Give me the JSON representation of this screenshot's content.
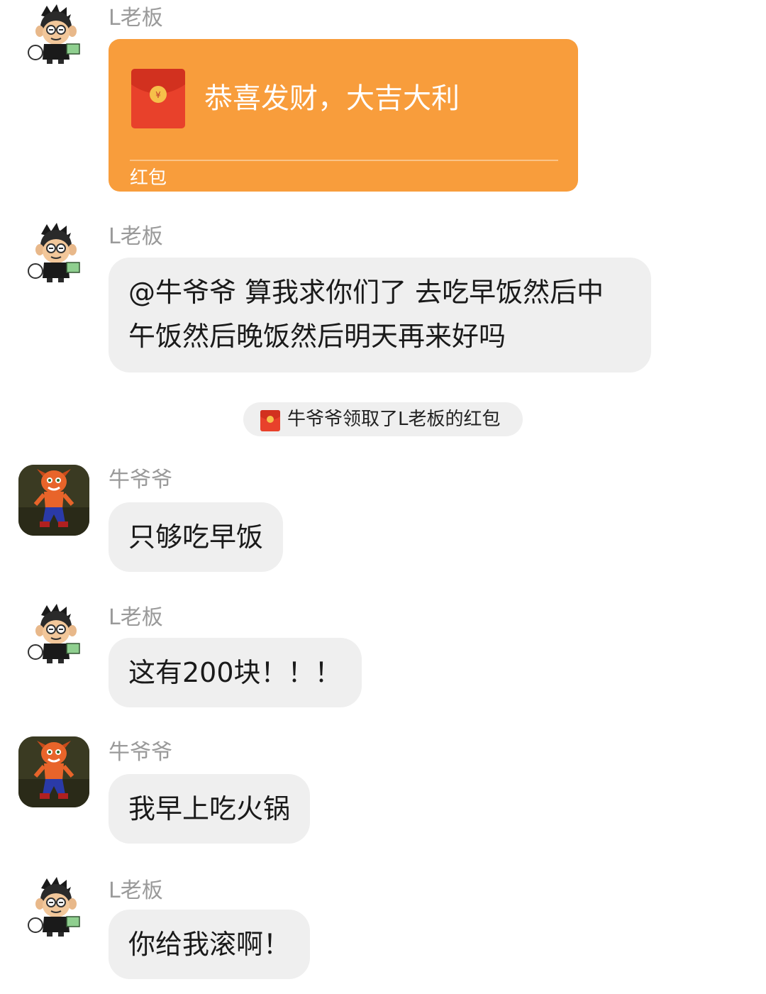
{
  "colors": {
    "red_packet_bg": "#f89d3c",
    "bubble_bg": "#efefef",
    "sender_name": "#9a9a9a"
  },
  "messages": [
    {
      "sender": "L老板",
      "avatar": "monkey-avatar",
      "type": "red_packet",
      "greeting": "恭喜发财，大吉大利",
      "label": "红包"
    },
    {
      "sender": "L老板",
      "avatar": "monkey-avatar",
      "type": "text",
      "line1": "@牛爷爷 算我求你们了 去吃早饭然后中",
      "line2": "午饭然后晚饭然后明天再来好吗"
    },
    {
      "type": "system",
      "icon": "red-packet-icon",
      "text": "牛爷爷领取了L老板的红包"
    },
    {
      "sender": "牛爷爷",
      "avatar": "crash-avatar",
      "type": "text",
      "text": "只够吃早饭"
    },
    {
      "sender": "L老板",
      "avatar": "monkey-avatar",
      "type": "text",
      "text": "这有200块！！！"
    },
    {
      "sender": "牛爷爷",
      "avatar": "crash-avatar",
      "type": "text",
      "text": "我早上吃火锅"
    },
    {
      "sender": "L老板",
      "avatar": "monkey-avatar",
      "type": "text",
      "text": "你给我滚啊！"
    }
  ]
}
